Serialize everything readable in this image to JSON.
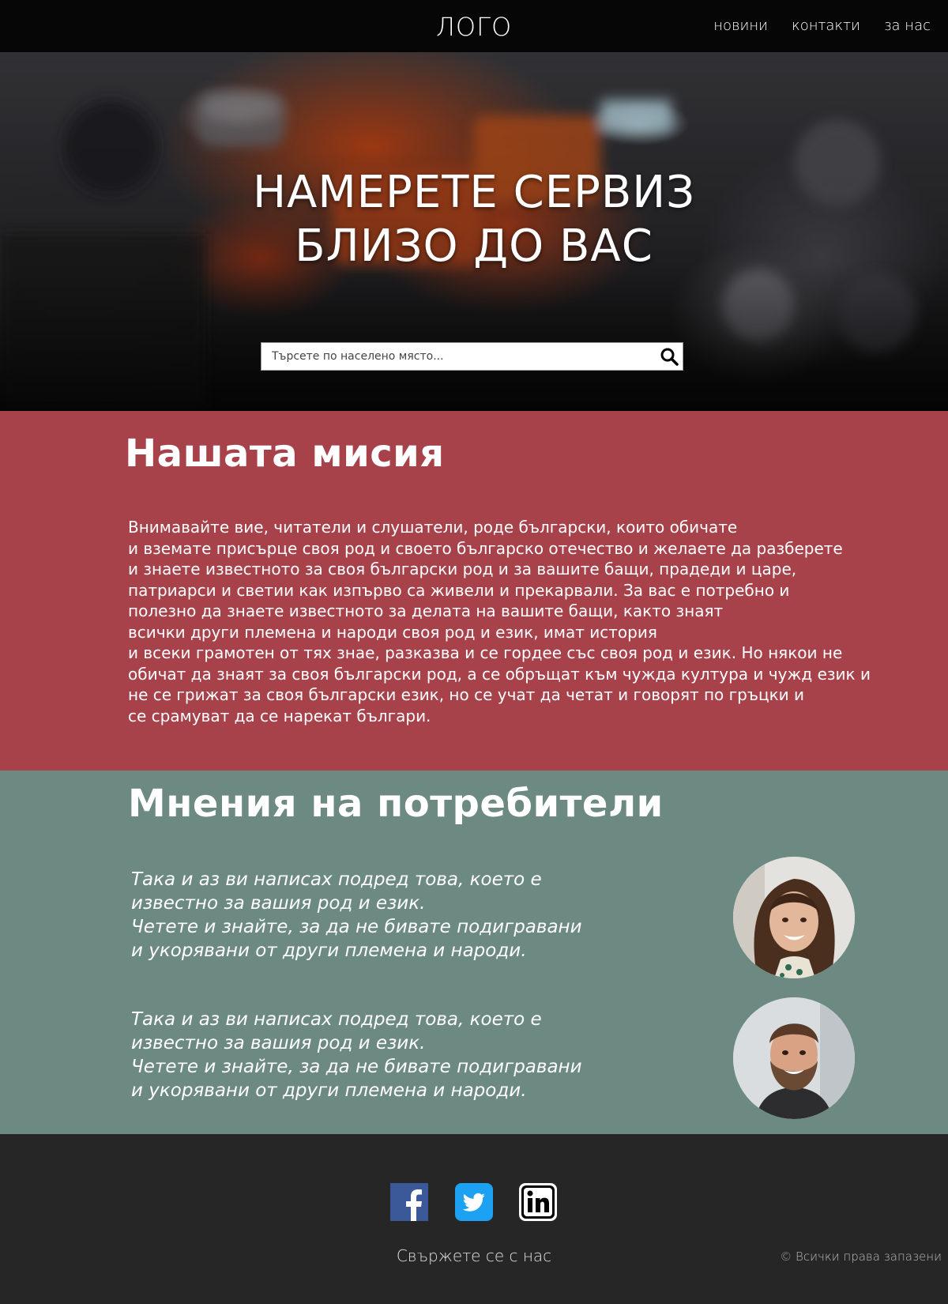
{
  "header": {
    "logo": "ЛОГО",
    "nav": [
      "новини",
      "контакти",
      "за нас"
    ]
  },
  "hero": {
    "title_lines": [
      "НАМЕРЕТЕ СЕРВИЗ",
      "БЛИЗО ДО ВАС"
    ],
    "search": {
      "placeholder": "Търсете по населено място...",
      "icon": "search-icon"
    }
  },
  "mission": {
    "title": "Нашата мисия",
    "lines": [
      "Внимавайте вие, читатели и слушатели, роде български, които обичате",
      "и вземате присърце своя род и своето българско отечество и желаете да разберете",
      "и знаете известното за своя български род и за вашите бащи, прадеди и царе,",
      "патриарси и светии как изпърво са живели и прекарвали. За вас е потребно и",
      "полезно да знаете известното за делата на вашите бащи, както знаят",
      "всички други племена и народи своя род и език, имат история",
      "и всеки грамотен от тях знае, разказва и се гордее със своя род и език. Но някои не",
      "обичат да знаят за своя български род, а се обръщат към чужда култура и чужд език и",
      "не се грижат за своя български език, но се учат да четат и говорят по гръцки и",
      "се срамуват да се нарекат българи."
    ]
  },
  "reviews": {
    "title": "Мнения на потребители",
    "items": [
      {
        "lines": [
          "Така и аз ви написах подред това, което е",
          "известно за вашия род и език.",
          "Четете и знайте, за да не бивате подигравани",
          "и укорявани от други племена и народи."
        ],
        "avatar": "woman-avatar"
      },
      {
        "lines": [
          "Така и аз ви написах подред това, което е",
          "известно за вашия род и език.",
          "Четете и знайте, за да не бивате подигравани",
          "и укорявани от други племена и народи."
        ],
        "avatar": "man-avatar"
      }
    ]
  },
  "footer": {
    "social": [
      "facebook-icon",
      "twitter-icon",
      "linkedin-icon"
    ],
    "contact": "Свържете се с нас",
    "copyright": "© Всички права запазени"
  },
  "colors": {
    "header_bg": "#060606",
    "mission_bg": "#a7424b",
    "reviews_bg": "#6c8a82",
    "footer_bg": "#262626"
  }
}
